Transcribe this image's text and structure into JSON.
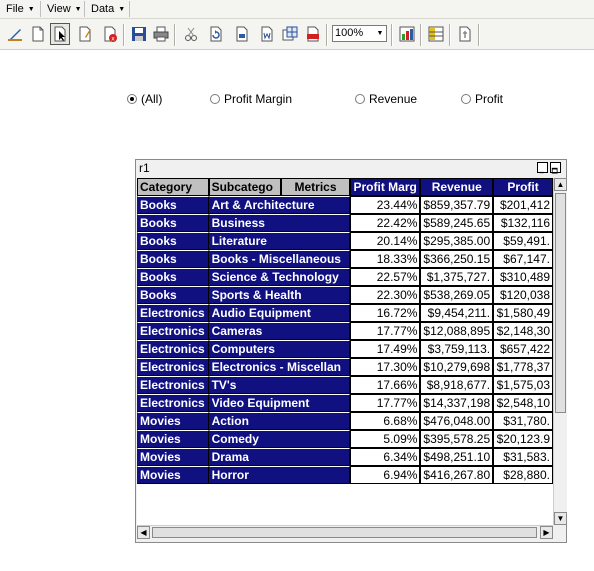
{
  "menubar": {
    "file": "File",
    "view": "View",
    "data": "Data"
  },
  "toolbar": {
    "icons": [
      "design-icon",
      "page-icon",
      "select-cursor-icon",
      "edit-page-icon",
      "delete-page-icon",
      "save-icon",
      "print-icon",
      "cut-icon",
      "refresh-icon",
      "export-icon",
      "export-word-icon",
      "export-excel-icon",
      "export-pdf-icon",
      "chart-icon",
      "grid-icon",
      "link-icon"
    ],
    "zoom": "100%"
  },
  "filters": {
    "all": "(All)",
    "profit_margin": "Profit Margin",
    "revenue": "Revenue",
    "profit": "Profit",
    "selected": "all"
  },
  "window": {
    "title": "r1"
  },
  "grid": {
    "headers": [
      "Category",
      "Subcatego",
      "Metrics",
      "Profit Marg",
      "Revenue",
      "Profit"
    ],
    "rows": [
      [
        "Books",
        "Art & Architecture",
        "23.44%",
        "$859,357.79",
        "$201,412"
      ],
      [
        "Books",
        "Business",
        "22.42%",
        "$589,245.65",
        "$132,116"
      ],
      [
        "Books",
        "Literature",
        "20.14%",
        "$295,385.00",
        "$59,491."
      ],
      [
        "Books",
        "Books - Miscellaneous",
        "18.33%",
        "$366,250.15",
        "$67,147."
      ],
      [
        "Books",
        "Science & Technology",
        "22.57%",
        "$1,375,727.",
        "$310,489"
      ],
      [
        "Books",
        "Sports & Health",
        "22.30%",
        "$538,269.05",
        "$120,038"
      ],
      [
        "Electronics",
        "Audio Equipment",
        "16.72%",
        "$9,454,211.",
        "$1,580,49"
      ],
      [
        "Electronics",
        "Cameras",
        "17.77%",
        "$12,088,895",
        "$2,148,30"
      ],
      [
        "Electronics",
        "Computers",
        "17.49%",
        "$3,759,113.",
        "$657,422"
      ],
      [
        "Electronics",
        "Electronics - Miscellan",
        "17.30%",
        "$10,279,698",
        "$1,778,37"
      ],
      [
        "Electronics",
        "TV's",
        "17.66%",
        "$8,918,677.",
        "$1,575,03"
      ],
      [
        "Electronics",
        "Video Equipment",
        "17.77%",
        "$14,337,198",
        "$2,548,10"
      ],
      [
        "Movies",
        "Action",
        "6.68%",
        "$476,048.00",
        "$31,780."
      ],
      [
        "Movies",
        "Comedy",
        "5.09%",
        "$395,578.25",
        "$20,123.9"
      ],
      [
        "Movies",
        "Drama",
        "6.34%",
        "$498,251.10",
        "$31,583."
      ],
      [
        "Movies",
        "Horror",
        "6.94%",
        "$416,267.80",
        "$28,880."
      ]
    ]
  }
}
